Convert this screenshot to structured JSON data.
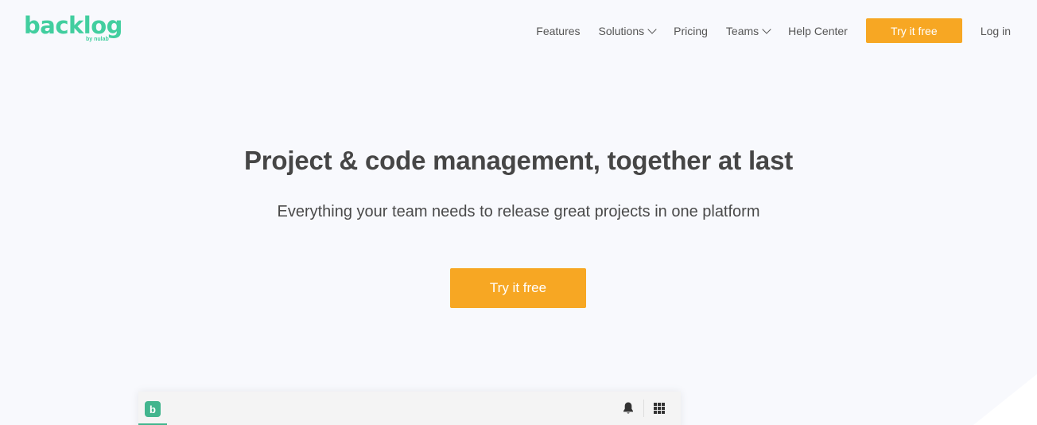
{
  "header": {
    "logo": {
      "word": "backlog",
      "by": "by nulab"
    },
    "nav": {
      "items": [
        {
          "label": "Features"
        },
        {
          "label": "Solutions",
          "dropdown": true
        },
        {
          "label": "Pricing"
        },
        {
          "label": "Teams",
          "dropdown": true
        },
        {
          "label": "Help Center"
        }
      ],
      "cta_label": "Try it free",
      "login_label": "Log in"
    }
  },
  "hero": {
    "title": "Project & code management, together at last",
    "subtitle": "Everything your team needs to release great projects in one platform",
    "cta_label": "Try it free"
  },
  "app_preview": {
    "logo_letter": "b",
    "icons": [
      "bell-icon",
      "grid-icon"
    ]
  },
  "colors": {
    "brand_green": "#42ce9f",
    "cta_orange": "#f7a723",
    "background": "#f8f9fd",
    "text": "#464646"
  }
}
